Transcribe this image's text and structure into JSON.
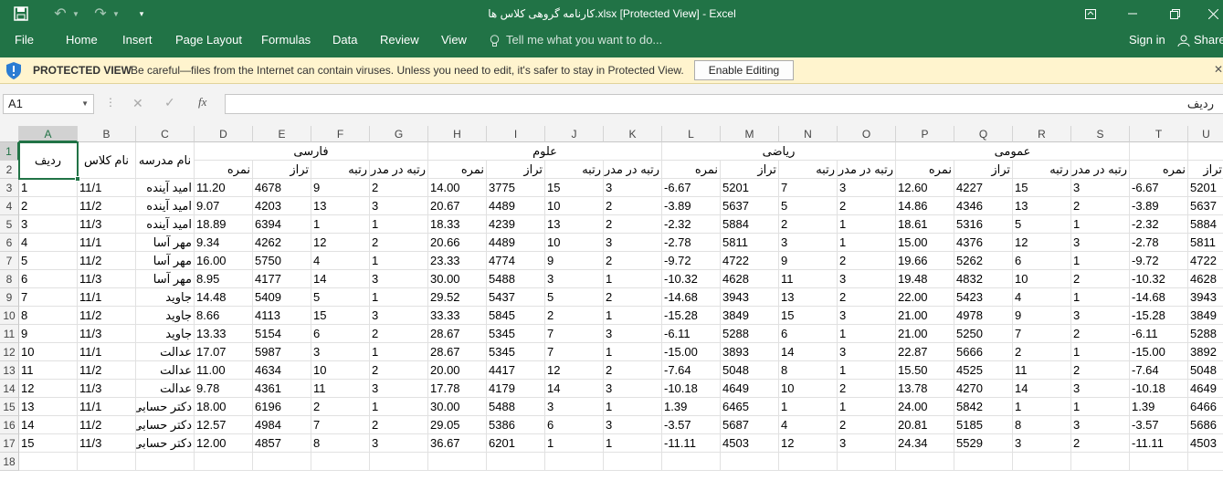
{
  "titlebar": {
    "title": "کارنامه گروهی کلاس ها.xlsx  [Protected View] - Excel",
    "qa_undo": "↶",
    "qa_redo": "↷"
  },
  "ribbon": {
    "tabs": [
      "File",
      "Home",
      "Insert",
      "Page Layout",
      "Formulas",
      "Data",
      "Review",
      "View"
    ],
    "tell_me": "Tell me what you want to do...",
    "sign_in": "Sign in",
    "share": "Share"
  },
  "protected_view": {
    "title": "PROTECTED VIEW",
    "message": "Be careful—files from the Internet can contain viruses. Unless you need to edit, it's safer to stay in Protected View.",
    "button": "Enable Editing"
  },
  "formula_bar": {
    "name_box": "A1",
    "fx": "fx",
    "value": "ردیف"
  },
  "columns": [
    "A",
    "B",
    "C",
    "D",
    "E",
    "F",
    "G",
    "H",
    "I",
    "J",
    "K",
    "L",
    "M",
    "N",
    "O",
    "P",
    "Q",
    "R",
    "S",
    "T",
    "U"
  ],
  "rows": [
    "1",
    "2",
    "3",
    "4",
    "5",
    "6",
    "7",
    "8",
    "9",
    "10",
    "11",
    "12",
    "13",
    "14",
    "15",
    "16",
    "17",
    "18"
  ],
  "headers": {
    "radif": "ردیف",
    "class_name": "نام کلاس",
    "school_name": "نام مدرسه",
    "groups": [
      "فارسی",
      "علوم",
      "ریاضی",
      "عمومی"
    ],
    "sub": [
      "نمره",
      "تراز",
      "رتبه",
      "رتبه در مدرسه"
    ],
    "t_partial": "نمره",
    "u_partial": "تراز"
  },
  "data_rows": [
    [
      "1",
      "11/1",
      "امید آینده",
      "11.20",
      "4678",
      "9",
      "2",
      "14.00",
      "3775",
      "15",
      "3",
      "-6.67",
      "5201",
      "7",
      "3",
      "12.60",
      "4227",
      "15",
      "3",
      "-6.67",
      "5201"
    ],
    [
      "2",
      "11/2",
      "امید آینده",
      "9.07",
      "4203",
      "13",
      "3",
      "20.67",
      "4489",
      "10",
      "2",
      "-3.89",
      "5637",
      "5",
      "2",
      "14.86",
      "4346",
      "13",
      "2",
      "-3.89",
      "5637"
    ],
    [
      "3",
      "11/3",
      "امید آینده",
      "18.89",
      "6394",
      "1",
      "1",
      "18.33",
      "4239",
      "13",
      "2",
      "-2.32",
      "5884",
      "2",
      "1",
      "18.61",
      "5316",
      "5",
      "1",
      "-2.32",
      "5884"
    ],
    [
      "4",
      "11/1",
      "مهر آسا",
      "9.34",
      "4262",
      "12",
      "2",
      "20.66",
      "4489",
      "10",
      "3",
      "-2.78",
      "5811",
      "3",
      "1",
      "15.00",
      "4376",
      "12",
      "3",
      "-2.78",
      "5811"
    ],
    [
      "5",
      "11/2",
      "مهر آسا",
      "16.00",
      "5750",
      "4",
      "1",
      "23.33",
      "4774",
      "9",
      "2",
      "-9.72",
      "4722",
      "9",
      "2",
      "19.66",
      "5262",
      "6",
      "1",
      "-9.72",
      "4722"
    ],
    [
      "6",
      "11/3",
      "مهر آسا",
      "8.95",
      "4177",
      "14",
      "3",
      "30.00",
      "5488",
      "3",
      "1",
      "-10.32",
      "4628",
      "11",
      "3",
      "19.48",
      "4832",
      "10",
      "2",
      "-10.32",
      "4628"
    ],
    [
      "7",
      "11/1",
      "جاوید",
      "14.48",
      "5409",
      "5",
      "1",
      "29.52",
      "5437",
      "5",
      "2",
      "-14.68",
      "3943",
      "13",
      "2",
      "22.00",
      "5423",
      "4",
      "1",
      "-14.68",
      "3943"
    ],
    [
      "8",
      "11/2",
      "جاوید",
      "8.66",
      "4113",
      "15",
      "3",
      "33.33",
      "5845",
      "2",
      "1",
      "-15.28",
      "3849",
      "15",
      "3",
      "21.00",
      "4978",
      "9",
      "3",
      "-15.28",
      "3849"
    ],
    [
      "9",
      "11/3",
      "جاوید",
      "13.33",
      "5154",
      "6",
      "2",
      "28.67",
      "5345",
      "7",
      "3",
      "-6.11",
      "5288",
      "6",
      "1",
      "21.00",
      "5250",
      "7",
      "2",
      "-6.11",
      "5288"
    ],
    [
      "10",
      "11/1",
      "عدالت",
      "17.07",
      "5987",
      "3",
      "1",
      "28.67",
      "5345",
      "7",
      "1",
      "-15.00",
      "3893",
      "14",
      "3",
      "22.87",
      "5666",
      "2",
      "1",
      "-15.00",
      "3892"
    ],
    [
      "11",
      "11/2",
      "عدالت",
      "11.00",
      "4634",
      "10",
      "2",
      "20.00",
      "4417",
      "12",
      "2",
      "-7.64",
      "5048",
      "8",
      "1",
      "15.50",
      "4525",
      "11",
      "2",
      "-7.64",
      "5048"
    ],
    [
      "12",
      "11/3",
      "عدالت",
      "9.78",
      "4361",
      "11",
      "3",
      "17.78",
      "4179",
      "14",
      "3",
      "-10.18",
      "4649",
      "10",
      "2",
      "13.78",
      "4270",
      "14",
      "3",
      "-10.18",
      "4649"
    ],
    [
      "13",
      "11/1",
      "دکتر حسابی",
      "18.00",
      "6196",
      "2",
      "1",
      "30.00",
      "5488",
      "3",
      "1",
      "1.39",
      "6465",
      "1",
      "1",
      "24.00",
      "5842",
      "1",
      "1",
      "1.39",
      "6466"
    ],
    [
      "14",
      "11/2",
      "دکتر حسابی",
      "12.57",
      "4984",
      "7",
      "2",
      "29.05",
      "5386",
      "6",
      "3",
      "-3.57",
      "5687",
      "4",
      "2",
      "20.81",
      "5185",
      "8",
      "3",
      "-3.57",
      "5686"
    ],
    [
      "15",
      "11/3",
      "دکتر حسابی",
      "12.00",
      "4857",
      "8",
      "3",
      "36.67",
      "6201",
      "1",
      "1",
      "-11.11",
      "4503",
      "12",
      "3",
      "24.34",
      "5529",
      "3",
      "2",
      "-11.11",
      "4503"
    ]
  ],
  "colors": {
    "excel_green": "#217346",
    "warning_bg": "#fff4ce",
    "shield_blue": "#2b7cd3"
  }
}
